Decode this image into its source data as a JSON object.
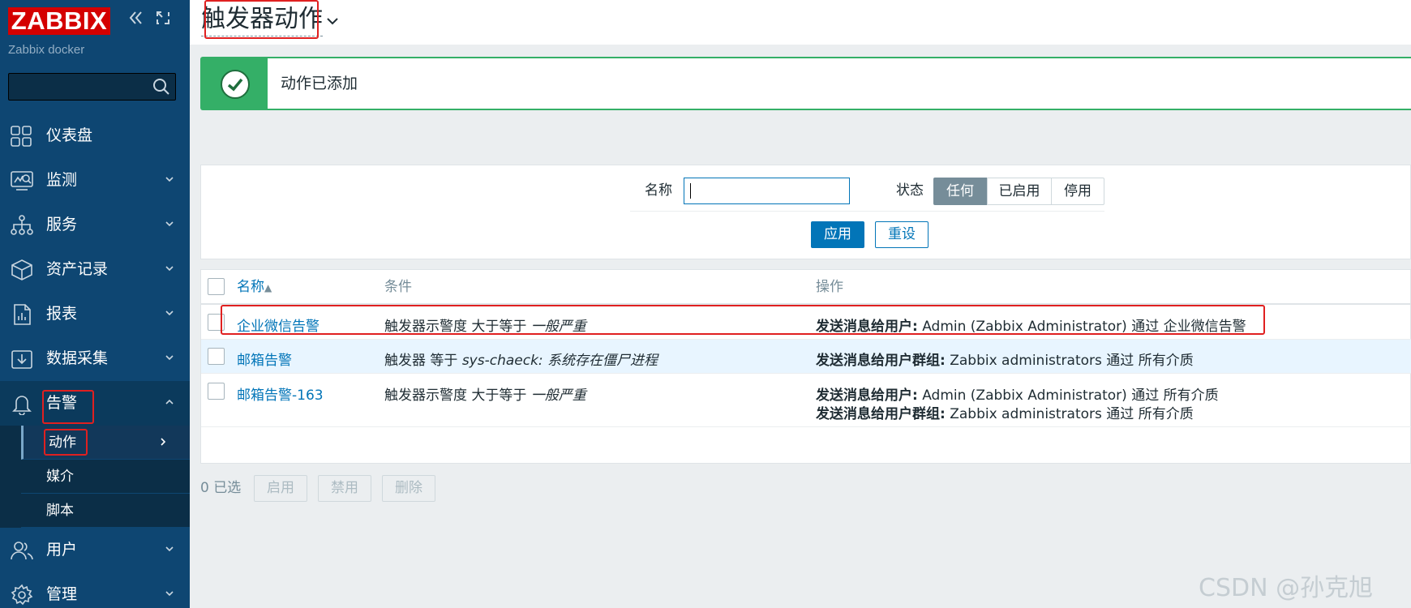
{
  "app": {
    "logo": "ZABBIX",
    "server_name": "Zabbix docker"
  },
  "sidebar": {
    "collapse_icon": "collapse-icon",
    "kiosk_icon": "kiosk-icon",
    "items": [
      {
        "label": "仪表盘",
        "icon": "dashboard-icon"
      },
      {
        "label": "监测",
        "icon": "monitoring-icon"
      },
      {
        "label": "服务",
        "icon": "services-icon"
      },
      {
        "label": "资产记录",
        "icon": "inventory-icon"
      },
      {
        "label": "报表",
        "icon": "reports-icon"
      },
      {
        "label": "数据采集",
        "icon": "data-collection-icon"
      },
      {
        "label": "告警",
        "icon": "alerts-bell-icon"
      },
      {
        "label": "用户",
        "icon": "users-icon"
      },
      {
        "label": "管理",
        "icon": "gear-icon"
      }
    ],
    "alerts_submenu": [
      {
        "label": "动作"
      },
      {
        "label": "媒介"
      },
      {
        "label": "脚本"
      }
    ]
  },
  "header": {
    "title": "触发器动作"
  },
  "message": {
    "text": "动作已添加"
  },
  "filter": {
    "name_label": "名称",
    "name_value": "",
    "status_label": "状态",
    "status_options": [
      "任何",
      "已启用",
      "停用"
    ],
    "status_selected": "任何",
    "apply_label": "应用",
    "reset_label": "重设"
  },
  "table": {
    "headers": {
      "name": "名称",
      "conditions": "条件",
      "operations": "操作"
    },
    "sort_indicator": "▲",
    "rows": [
      {
        "name": "企业微信告警",
        "condition_prefix": "触发器示警度 大于等于 ",
        "condition_value": "一般严重",
        "operations": [
          {
            "bold": "发送消息给用户:",
            "text": " Admin (Zabbix Administrator) 通过 企业微信告警"
          }
        ]
      },
      {
        "name": "邮箱告警",
        "condition_prefix": "触发器 等于 ",
        "condition_value": "sys-chaeck: 系统存在僵尸进程",
        "operations": [
          {
            "bold": "发送消息给用户群组:",
            "text": " Zabbix administrators 通过 所有介质"
          }
        ]
      },
      {
        "name": "邮箱告警-163",
        "condition_prefix": "触发器示警度 大于等于 ",
        "condition_value": "一般严重",
        "operations": [
          {
            "bold": "发送消息给用户:",
            "text": " Admin (Zabbix Administrator) 通过 所有介质"
          },
          {
            "bold": "发送消息给用户群组:",
            "text": " Zabbix administrators 通过 所有介质"
          }
        ]
      }
    ]
  },
  "footer": {
    "selected_count": "0 已选",
    "enable_label": "启用",
    "disable_label": "禁用",
    "delete_label": "删除"
  },
  "watermark": "CSDN @孙克旭",
  "colors": {
    "sidebar_bg": "#0e4672",
    "logo_red": "#d40000",
    "link_blue": "#0275b8",
    "success_green": "#34af67",
    "annotation_red": "#e02020"
  }
}
